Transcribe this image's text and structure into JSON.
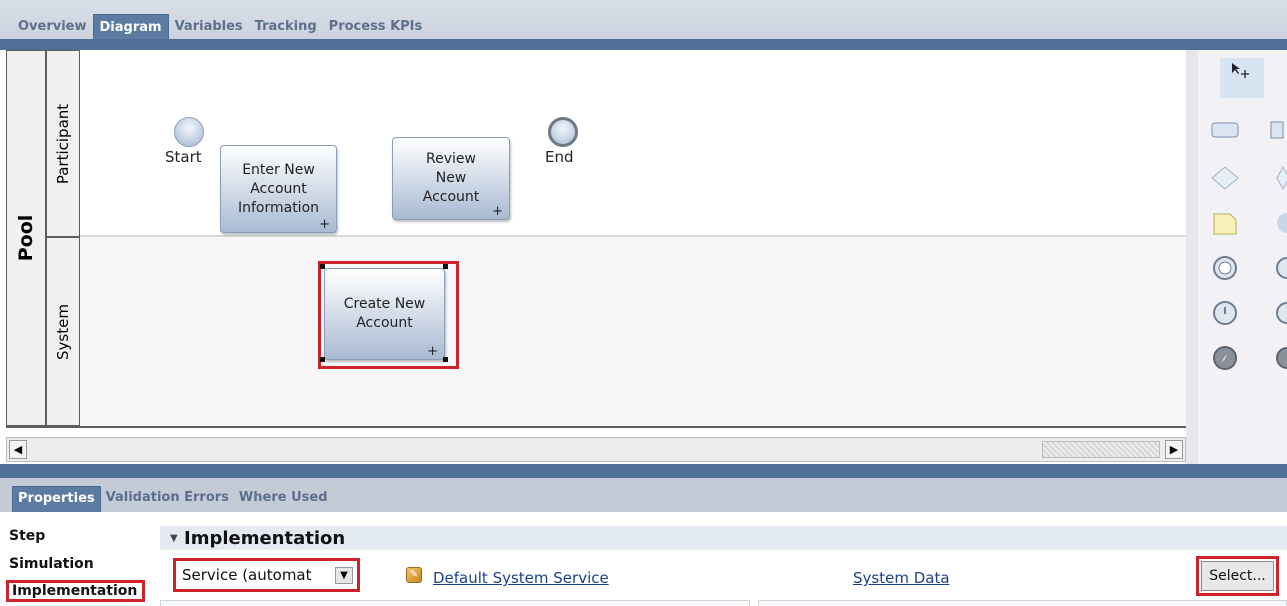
{
  "top_tabs": [
    "Overview",
    "Diagram",
    "Variables",
    "Tracking",
    "Process KPIs"
  ],
  "active_top_tab": "Diagram",
  "diagram": {
    "pool_label": "Pool",
    "lanes": [
      "Participant",
      "System"
    ],
    "start_label": "Start",
    "end_label": "End",
    "activities": {
      "enter_new_account": "Enter New\nAccount\nInformation",
      "review_new_account": "Review\nNew\nAccount",
      "create_new_account": "Create New\nAccount"
    },
    "expand_marker": "+"
  },
  "scrollbar": {
    "left_arrow": "◀",
    "right_arrow": "▶"
  },
  "palette": {
    "tool": "select-tool",
    "icons": [
      "select-icon",
      "task-icon",
      "subprocess-icon",
      "gateway-icon",
      "note-icon",
      "intermediate-event-icon",
      "timer-icon",
      "message-icon",
      "error-icon"
    ]
  },
  "properties": {
    "tabs": [
      "Properties",
      "Validation Errors",
      "Where Used"
    ],
    "active_tab": "Properties",
    "sidebar": [
      "Step",
      "Simulation",
      "Implementation"
    ],
    "selected_sidebar": "Implementation",
    "section_title": "Implementation",
    "implementation_type": "Service (automat",
    "service_link": "Default System Service",
    "system_data_link": "System Data",
    "select_button": "Select..."
  },
  "colors": {
    "accent_blue": "#5b7ba3",
    "highlight_red": "#d0202a"
  }
}
